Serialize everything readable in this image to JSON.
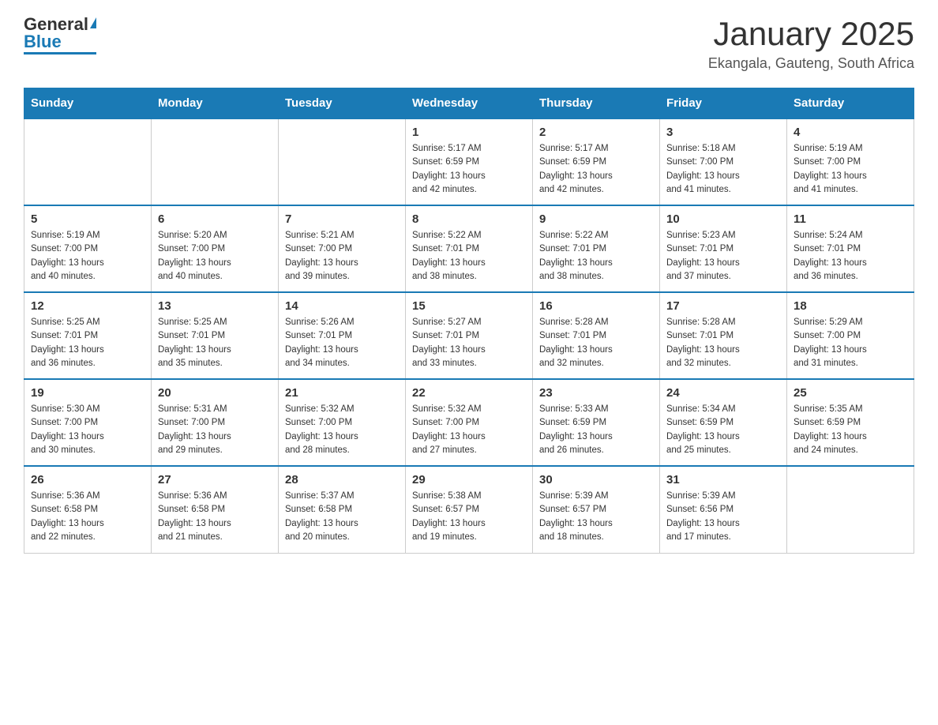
{
  "header": {
    "logo_general": "General",
    "logo_blue": "Blue",
    "month_title": "January 2025",
    "location": "Ekangala, Gauteng, South Africa"
  },
  "days_of_week": [
    "Sunday",
    "Monday",
    "Tuesday",
    "Wednesday",
    "Thursday",
    "Friday",
    "Saturday"
  ],
  "weeks": [
    [
      {
        "day": "",
        "info": ""
      },
      {
        "day": "",
        "info": ""
      },
      {
        "day": "",
        "info": ""
      },
      {
        "day": "1",
        "info": "Sunrise: 5:17 AM\nSunset: 6:59 PM\nDaylight: 13 hours\nand 42 minutes."
      },
      {
        "day": "2",
        "info": "Sunrise: 5:17 AM\nSunset: 6:59 PM\nDaylight: 13 hours\nand 42 minutes."
      },
      {
        "day": "3",
        "info": "Sunrise: 5:18 AM\nSunset: 7:00 PM\nDaylight: 13 hours\nand 41 minutes."
      },
      {
        "day": "4",
        "info": "Sunrise: 5:19 AM\nSunset: 7:00 PM\nDaylight: 13 hours\nand 41 minutes."
      }
    ],
    [
      {
        "day": "5",
        "info": "Sunrise: 5:19 AM\nSunset: 7:00 PM\nDaylight: 13 hours\nand 40 minutes."
      },
      {
        "day": "6",
        "info": "Sunrise: 5:20 AM\nSunset: 7:00 PM\nDaylight: 13 hours\nand 40 minutes."
      },
      {
        "day": "7",
        "info": "Sunrise: 5:21 AM\nSunset: 7:00 PM\nDaylight: 13 hours\nand 39 minutes."
      },
      {
        "day": "8",
        "info": "Sunrise: 5:22 AM\nSunset: 7:01 PM\nDaylight: 13 hours\nand 38 minutes."
      },
      {
        "day": "9",
        "info": "Sunrise: 5:22 AM\nSunset: 7:01 PM\nDaylight: 13 hours\nand 38 minutes."
      },
      {
        "day": "10",
        "info": "Sunrise: 5:23 AM\nSunset: 7:01 PM\nDaylight: 13 hours\nand 37 minutes."
      },
      {
        "day": "11",
        "info": "Sunrise: 5:24 AM\nSunset: 7:01 PM\nDaylight: 13 hours\nand 36 minutes."
      }
    ],
    [
      {
        "day": "12",
        "info": "Sunrise: 5:25 AM\nSunset: 7:01 PM\nDaylight: 13 hours\nand 36 minutes."
      },
      {
        "day": "13",
        "info": "Sunrise: 5:25 AM\nSunset: 7:01 PM\nDaylight: 13 hours\nand 35 minutes."
      },
      {
        "day": "14",
        "info": "Sunrise: 5:26 AM\nSunset: 7:01 PM\nDaylight: 13 hours\nand 34 minutes."
      },
      {
        "day": "15",
        "info": "Sunrise: 5:27 AM\nSunset: 7:01 PM\nDaylight: 13 hours\nand 33 minutes."
      },
      {
        "day": "16",
        "info": "Sunrise: 5:28 AM\nSunset: 7:01 PM\nDaylight: 13 hours\nand 32 minutes."
      },
      {
        "day": "17",
        "info": "Sunrise: 5:28 AM\nSunset: 7:01 PM\nDaylight: 13 hours\nand 32 minutes."
      },
      {
        "day": "18",
        "info": "Sunrise: 5:29 AM\nSunset: 7:00 PM\nDaylight: 13 hours\nand 31 minutes."
      }
    ],
    [
      {
        "day": "19",
        "info": "Sunrise: 5:30 AM\nSunset: 7:00 PM\nDaylight: 13 hours\nand 30 minutes."
      },
      {
        "day": "20",
        "info": "Sunrise: 5:31 AM\nSunset: 7:00 PM\nDaylight: 13 hours\nand 29 minutes."
      },
      {
        "day": "21",
        "info": "Sunrise: 5:32 AM\nSunset: 7:00 PM\nDaylight: 13 hours\nand 28 minutes."
      },
      {
        "day": "22",
        "info": "Sunrise: 5:32 AM\nSunset: 7:00 PM\nDaylight: 13 hours\nand 27 minutes."
      },
      {
        "day": "23",
        "info": "Sunrise: 5:33 AM\nSunset: 6:59 PM\nDaylight: 13 hours\nand 26 minutes."
      },
      {
        "day": "24",
        "info": "Sunrise: 5:34 AM\nSunset: 6:59 PM\nDaylight: 13 hours\nand 25 minutes."
      },
      {
        "day": "25",
        "info": "Sunrise: 5:35 AM\nSunset: 6:59 PM\nDaylight: 13 hours\nand 24 minutes."
      }
    ],
    [
      {
        "day": "26",
        "info": "Sunrise: 5:36 AM\nSunset: 6:58 PM\nDaylight: 13 hours\nand 22 minutes."
      },
      {
        "day": "27",
        "info": "Sunrise: 5:36 AM\nSunset: 6:58 PM\nDaylight: 13 hours\nand 21 minutes."
      },
      {
        "day": "28",
        "info": "Sunrise: 5:37 AM\nSunset: 6:58 PM\nDaylight: 13 hours\nand 20 minutes."
      },
      {
        "day": "29",
        "info": "Sunrise: 5:38 AM\nSunset: 6:57 PM\nDaylight: 13 hours\nand 19 minutes."
      },
      {
        "day": "30",
        "info": "Sunrise: 5:39 AM\nSunset: 6:57 PM\nDaylight: 13 hours\nand 18 minutes."
      },
      {
        "day": "31",
        "info": "Sunrise: 5:39 AM\nSunset: 6:56 PM\nDaylight: 13 hours\nand 17 minutes."
      },
      {
        "day": "",
        "info": ""
      }
    ]
  ]
}
